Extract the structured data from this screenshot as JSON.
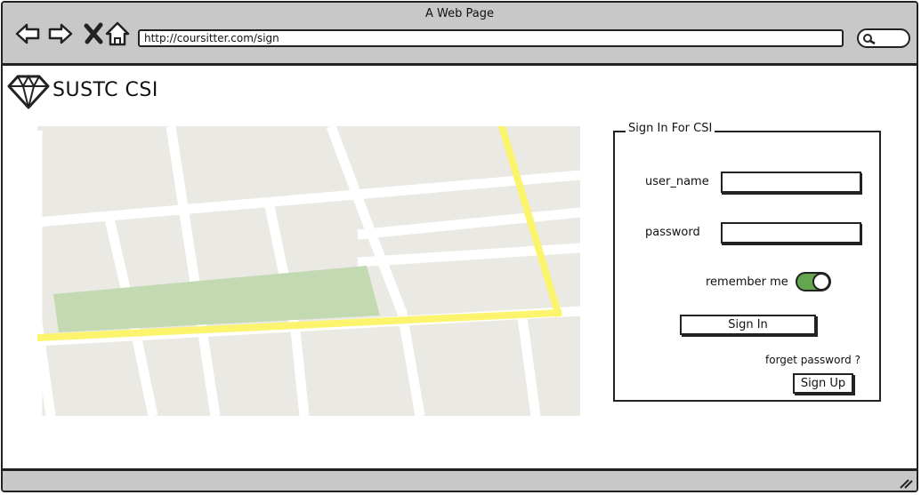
{
  "window": {
    "title": "A Web Page"
  },
  "toolbar": {
    "url": "http://coursitter.com/sign",
    "icons": [
      "back-arrow-icon",
      "forward-arrow-icon",
      "close-x-icon",
      "home-icon",
      "search-icon"
    ]
  },
  "header": {
    "brand": "SUSTC CSI",
    "logo_icon": "diamond-icon"
  },
  "map": {
    "icon": "map-placeholder"
  },
  "login": {
    "legend": "Sign In For CSI",
    "username_label": "user_name",
    "username_value": "",
    "password_label": "password",
    "password_value": "",
    "remember_label": "remember me",
    "remember_on": true,
    "sign_in_label": "Sign In",
    "forgot_label": "forget password ?",
    "sign_up_label": "Sign Up"
  },
  "colors": {
    "chrome": "#c8c8c8",
    "toggle_on": "#64a550",
    "map_road": "#ffffff",
    "map_highlight_road": "#fcf46c",
    "map_park": "#c2d9b2",
    "map_block": "#ebe9e3"
  }
}
